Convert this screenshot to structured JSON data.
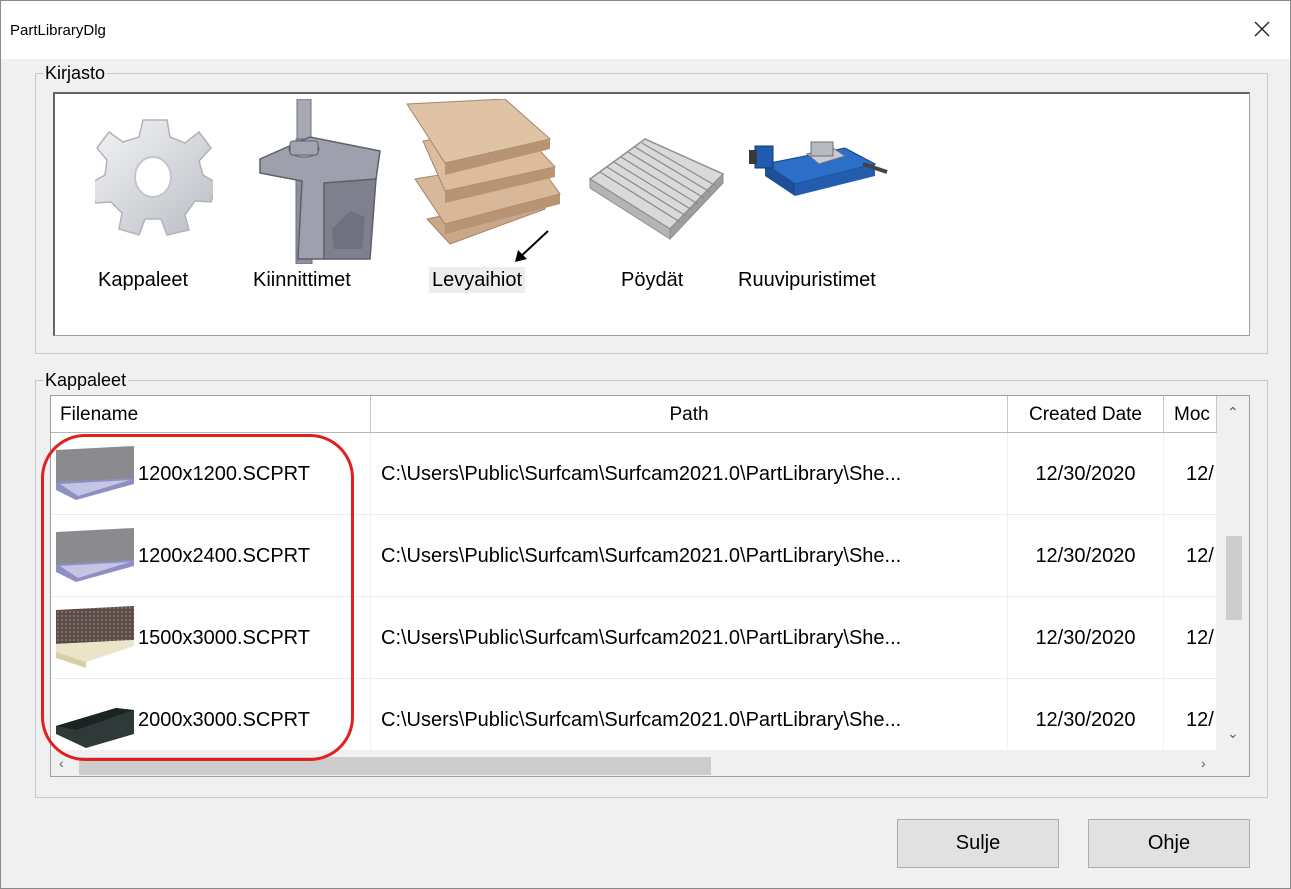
{
  "window": {
    "title": "PartLibraryDlg"
  },
  "library": {
    "group_label": "Kirjasto",
    "items": [
      {
        "label": "Kappaleet",
        "icon": "gear-icon"
      },
      {
        "label": "Kiinnittimet",
        "icon": "clamp-icon"
      },
      {
        "label": "Levyaihiot",
        "icon": "wood-sheets-icon",
        "selected": true
      },
      {
        "label": "Pöydät",
        "icon": "slotted-table-icon"
      },
      {
        "label": "Ruuvipuristimet",
        "icon": "vise-icon"
      }
    ]
  },
  "parts": {
    "group_label": "Kappaleet",
    "columns": [
      "Filename",
      "Path",
      "Created Date",
      "Moc"
    ],
    "rows": [
      {
        "filename": "1200x1200.SCPRT",
        "path": "C:\\Users\\Public\\Surfcam\\Surfcam2021.0\\PartLibrary\\She...",
        "created": "12/30/2020",
        "modified": "12/",
        "thumb": "gray-sheet-thumbnail"
      },
      {
        "filename": "1200x2400.SCPRT",
        "path": "C:\\Users\\Public\\Surfcam\\Surfcam2021.0\\PartLibrary\\She...",
        "created": "12/30/2020",
        "modified": "12/",
        "thumb": "gray-sheet-thumbnail"
      },
      {
        "filename": "1500x3000.SCPRT",
        "path": "C:\\Users\\Public\\Surfcam\\Surfcam2021.0\\PartLibrary\\She...",
        "created": "12/30/2020",
        "modified": "12/",
        "thumb": "textured-sheet-thumbnail"
      },
      {
        "filename": "2000x3000.SCPRT",
        "path": "C:\\Users\\Public\\Surfcam\\Surfcam2021.0\\PartLibrary\\She...",
        "created": "12/30/2020",
        "modified": "12/",
        "thumb": "dark-sheet-thumbnail"
      }
    ],
    "scroll": {
      "vertical_position": 0.4,
      "horizontal_position": 0
    }
  },
  "buttons": {
    "close": "Sulje",
    "help": "Ohje"
  },
  "colors": {
    "highlight": "#e02020",
    "selection_bg": "#ededed"
  }
}
